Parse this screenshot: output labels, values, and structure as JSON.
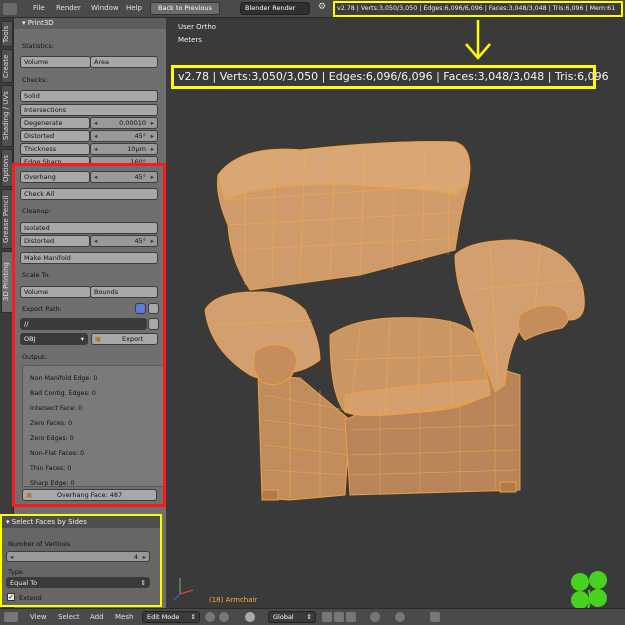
{
  "topbar": {
    "menus": [
      "File",
      "Render",
      "Window",
      "Help"
    ],
    "back_button": "Back to Previous",
    "render_engine": "Blender Render",
    "stats": "v2.78 | Verts:3,050/3,050 | Edges:6,096/6,096 | Faces:3,048/3,048 | Tris:6,096 | Mem:61"
  },
  "tabs": [
    "Tools",
    "Create",
    "Shading / UVs",
    "Options",
    "Grease Pencil",
    "3D Printing"
  ],
  "print3d": {
    "title": "Print3D",
    "statistics_label": "Statistics:",
    "volume_label": "Volume",
    "area_label": "Area",
    "checks_label": "Checks:",
    "solid_label": "Solid",
    "intersections_label": "Intersections",
    "degenerate_label": "Degenerate",
    "degenerate_value": "0.00010",
    "distorted_label": "Distorted",
    "distorted_value": "45°",
    "thickness_label": "Thickness",
    "thickness_value": "10µm",
    "edge_sharp_label": "Edge Sharp",
    "edge_sharp_value": "160°",
    "overhang_label": "Overhang",
    "overhang_value": "45°",
    "check_all_label": "Check All",
    "cleanup_label": "Cleanup:",
    "isolated_label": "Isolated",
    "distorted2_label": "Distorted",
    "distorted2_value": "45°",
    "make_manifold_label": "Make Manifold",
    "scale_to_label": "Scale To:",
    "volume2_label": "Volume",
    "bounds_label": "Bounds",
    "export_path_label": "Export Path:",
    "export_path_value": "//",
    "format_value": "OBJ",
    "export_label": "Export",
    "output_label": "Output:",
    "output_lines": [
      "Non Manifold Edge: 0",
      "Bad Contig. Edges: 0",
      "Intersect Face: 0",
      "Zero Faces: 0",
      "Zero Edges: 0",
      "Non-Flat Faces: 0",
      "Thin Faces: 0",
      "Sharp Edge: 0"
    ],
    "overhang_face_label": "Overhang Face: 487"
  },
  "select_faces": {
    "title": "Select Faces by Sides",
    "vertices_label": "Number of Vertices",
    "vertices_value": "4",
    "type_label": "Type",
    "type_value": "Equal To",
    "extend_label": "Extend"
  },
  "viewport": {
    "view_name": "User Ortho",
    "units": "Meters",
    "stats": "v2.78 | Verts:3,050/3,050 | Edges:6,096/6,096 | Faces:3,048/3,048 | Tris:6,096",
    "object_label": "(18) Armchair"
  },
  "bottombar": {
    "menus": [
      "View",
      "Select",
      "Add",
      "Mesh"
    ],
    "mode": "Edit Mode",
    "orientation": "Global"
  },
  "colors": {
    "highlight_yellow": "#ffff00",
    "highlight_red": "#ff1a1a",
    "mesh_orange": "#f0a040",
    "clover_green": "#46d21e"
  }
}
